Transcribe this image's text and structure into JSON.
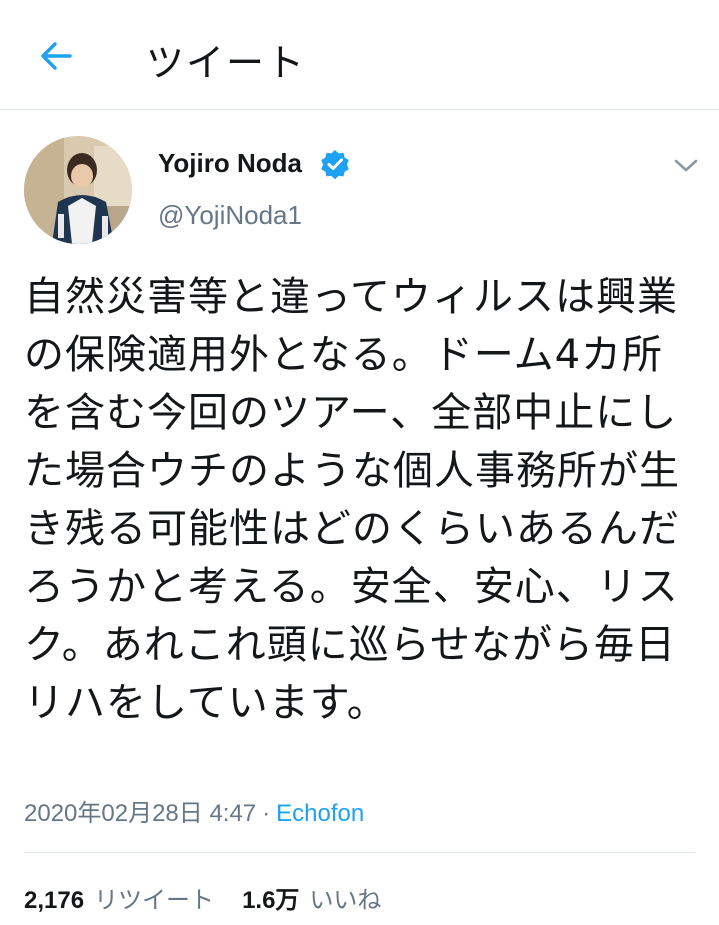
{
  "header": {
    "title": "ツイート"
  },
  "tweet": {
    "author_name": "Yojiro Noda",
    "author_handle": "@YojiNoda1",
    "text": "自然災害等と違ってウィルスは興業の保険適用外となる。ドーム4カ所を含む今回のツアー、全部中止にした場合ウチのような個人事務所が生き残る可能性はどのくらいあるんだろうかと考える。安全、安心、リスク。あれこれ頭に巡らせながら毎日リハをしています。",
    "timestamp": "2020年02月28日 4:47",
    "separator": "·",
    "source": "Echofon"
  },
  "stats": {
    "retweets_count": "2,176",
    "retweets_label": "リツイート",
    "likes_count": "1.6万",
    "likes_label": "いいね"
  },
  "icons": {
    "back": "arrow-left-icon",
    "verified": "verified-badge-icon",
    "caret": "chevron-down-icon"
  },
  "colors": {
    "accent": "#1da1f2",
    "text": "#14171a",
    "secondary": "#657786",
    "divider": "#e1e8ed"
  }
}
